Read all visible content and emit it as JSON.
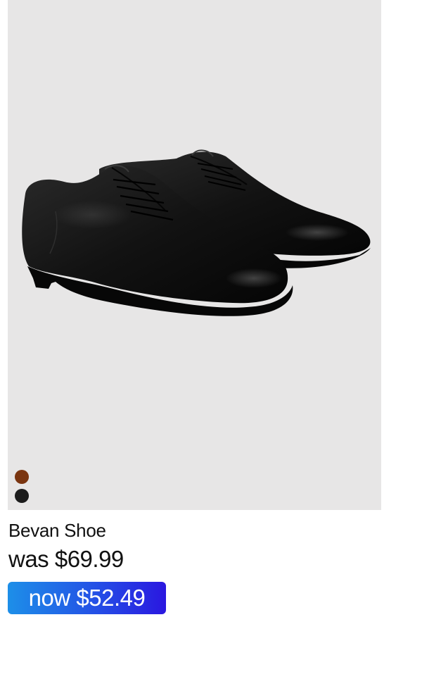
{
  "product": {
    "image_alt": "Black leather lace-up derby shoes",
    "name": "Bevan Shoe",
    "was_price": "was $69.99",
    "now_prefix": "now",
    "now_price": "$52.49"
  },
  "swatches": [
    {
      "name": "brown",
      "color": "#7a3510"
    },
    {
      "name": "black",
      "color": "#1c1c1c"
    }
  ],
  "colors": {
    "image_background": "#e7e6e6",
    "badge_gradient_start": "#1d8fe8",
    "badge_gradient_end": "#2a17e0"
  }
}
